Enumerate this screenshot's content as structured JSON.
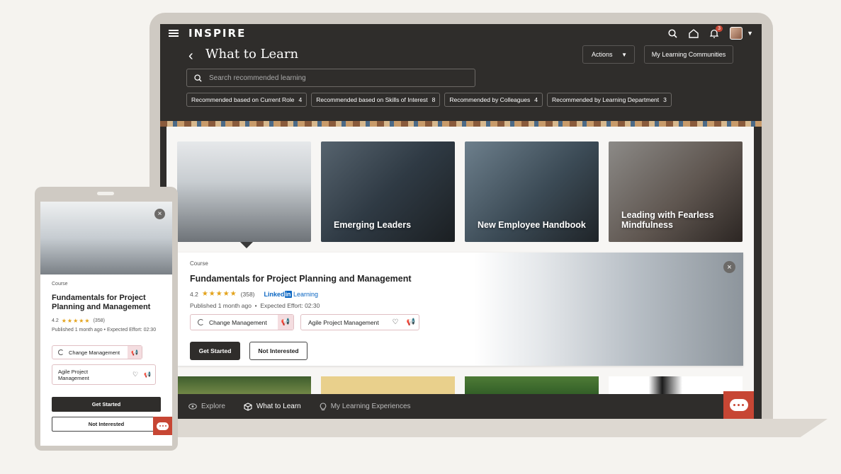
{
  "app": {
    "brand": "INSPIRE",
    "notification_count": "3"
  },
  "header": {
    "title": "What to Learn",
    "actions_label": "Actions",
    "communities_label": "My Learning Communities"
  },
  "search": {
    "placeholder": "Search recommended learning"
  },
  "chips": [
    {
      "label": "Recommended based on Current Role",
      "count": "4"
    },
    {
      "label": "Recommended based on Skills of Interest",
      "count": "8"
    },
    {
      "label": "Recommended by Colleagues",
      "count": "4"
    },
    {
      "label": "Recommended by Learning Department",
      "count": "3"
    }
  ],
  "cards": [
    {
      "caption": ""
    },
    {
      "caption": "Emerging Leaders"
    },
    {
      "caption": "New Employee Handbook"
    },
    {
      "caption": "Leading with Fearless Mindfulness"
    }
  ],
  "detail": {
    "kind": "Course",
    "title": "Fundamentals for Project Planning and Management",
    "rating": "4.2",
    "stars": "★★★★★",
    "reviews": "(358)",
    "provider_a": "Linked",
    "provider_b": "in",
    "provider_c": " Learning",
    "published": "Published 1 month ago",
    "effort": "Expected Effort: 02:30",
    "skills": [
      "Change Management",
      "Agile Project Management"
    ],
    "get_started": "Get Started",
    "not_interested": "Not Interested"
  },
  "bottom_nav": [
    {
      "label": "Explore"
    },
    {
      "label": "What to Learn"
    },
    {
      "label": "My Learning Experiences"
    }
  ],
  "phone": {
    "kind": "Course",
    "title": "Fundamentals for Project Planning and Management",
    "rating": "4.2",
    "stars": "★★★★★",
    "reviews": "(358)",
    "published": "Published 1 month ago  •  Expected Effort: 02:30",
    "skills": [
      "Change Management",
      "Agile Project Management"
    ],
    "get_started": "Get Started",
    "not_interested": "Not Interested"
  },
  "colors": {
    "accent": "#c74634",
    "dark": "#2f2d2b",
    "star": "#e3a21a"
  }
}
